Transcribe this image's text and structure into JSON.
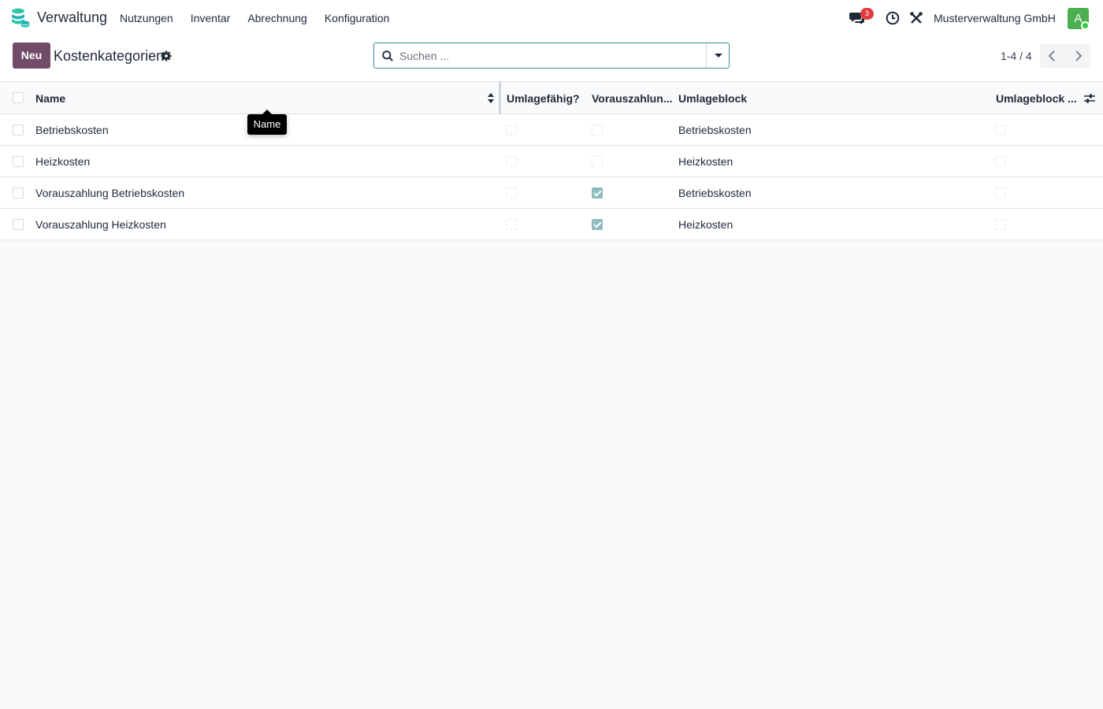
{
  "navbar": {
    "app_name": "Verwaltung",
    "app_logo_icon": "database-stack-icon",
    "menu": [
      "Nutzungen",
      "Inventar",
      "Abrechnung",
      "Konfiguration"
    ],
    "chat_badge": "3",
    "company": "Musterverwaltung GmbH",
    "avatar_initial": "A"
  },
  "control": {
    "new_label": "Neu",
    "title": "Kostenkategorien",
    "search_placeholder": "Suchen ...",
    "pager": "1-4 / 4"
  },
  "table": {
    "headers": {
      "name": "Name",
      "umlagefaehig": "Umlagefähig?",
      "vorauszahlung": "Vorauszahlun...",
      "umlageblock": "Umlageblock",
      "umlageblock2": "Umlageblock ..."
    },
    "rows": [
      {
        "name": "Betriebskosten",
        "umlagefaehig": false,
        "vorauszahlung": false,
        "umlageblock": "Betriebskosten",
        "umlageblock2": false
      },
      {
        "name": "Heizkosten",
        "umlagefaehig": false,
        "vorauszahlung": false,
        "umlageblock": "Heizkosten",
        "umlageblock2": false
      },
      {
        "name": "Vorauszahlung Betriebskosten",
        "umlagefaehig": false,
        "vorauszahlung": true,
        "umlageblock": "Betriebskosten",
        "umlageblock2": false
      },
      {
        "name": "Vorauszahlung Heizkosten",
        "umlagefaehig": false,
        "vorauszahlung": true,
        "umlageblock": "Heizkosten",
        "umlageblock2": false
      }
    ]
  },
  "tooltip": "Name",
  "colors": {
    "brand": "#714b67",
    "accent": "#3f8a91",
    "checked": "#8fbcc0",
    "badge": "#e03d3d",
    "avatar": "#4caf50"
  }
}
